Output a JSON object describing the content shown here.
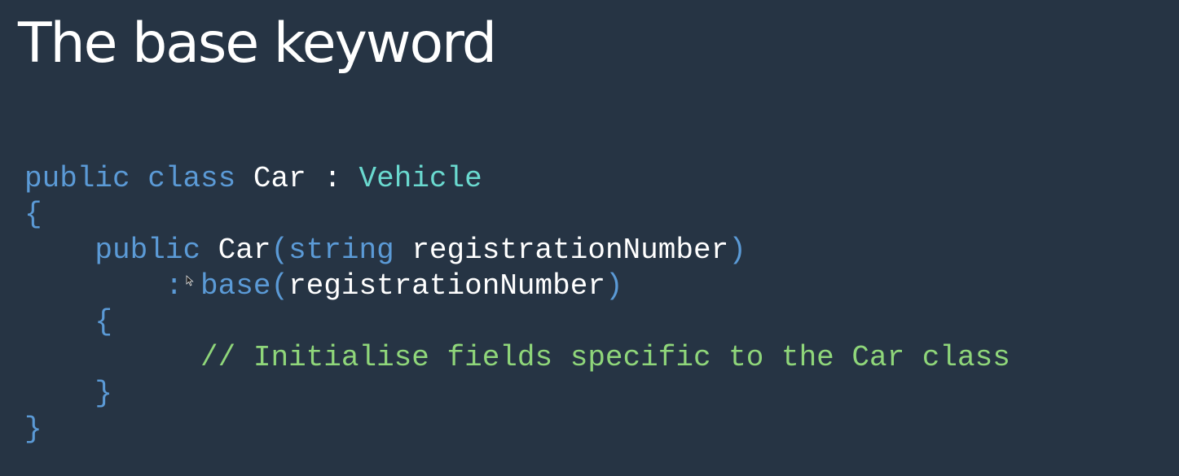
{
  "slide": {
    "title": "The base keyword"
  },
  "code": {
    "line1": {
      "kw_public": "public",
      "kw_class": "class",
      "class_name": "Car",
      "colon": ":",
      "base_type": "Vehicle"
    },
    "line2": {
      "brace_open": "{"
    },
    "line3": {
      "kw_public": "public",
      "ctor_name": "Car",
      "paren_open": "(",
      "kw_string": "string",
      "param_name": "registrationNumber",
      "paren_close": ")"
    },
    "line4": {
      "colon": ":",
      "kw_base": "base",
      "paren_open": "(",
      "arg_name": "registrationNumber",
      "paren_close": ")"
    },
    "line5": {
      "brace_open": "{"
    },
    "line6": {
      "comment": "// Initialise fields specific to the Car class"
    },
    "line7": {
      "brace_close": "}"
    },
    "line8": {
      "brace_close": "}"
    }
  },
  "colors": {
    "background": "#263444",
    "keyword": "#5b9ad6",
    "type": "#6ad9cf",
    "comment": "#8fd67a",
    "text": "#ffffff"
  },
  "icons": {
    "cursor": "mouse-pointer-icon"
  }
}
